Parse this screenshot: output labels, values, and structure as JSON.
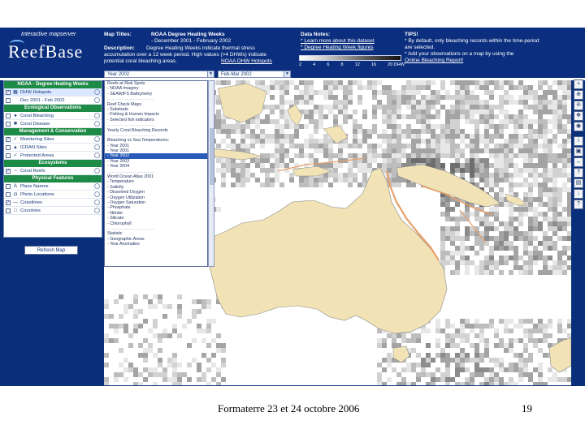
{
  "app": {
    "tagline": "Interactive mapserver",
    "logo": "ReefBase"
  },
  "header": {
    "map_titles_label": "Map Titles:",
    "map_title_line1": "NOAA Degree Heating Weeks",
    "map_title_line2": "- December 2001 - February 2002",
    "description_label": "Description:",
    "description_line1": "Degree Heating Weeks indicate thermal stress",
    "description_line2": "accumulation over a 12 week period. High values (>4 DHWs) indicate",
    "description_line3": "potential coral bleaching areas.",
    "description_link": "NOAA DHW Hotspots",
    "data_notes_label": "Data Notes:",
    "data_notes_1": "* Learn more about this dataset",
    "data_notes_2": "* Degree Heating Week figures",
    "legend_ticks": [
      "2",
      "4",
      "6",
      "8",
      "12",
      "16",
      "20 DHW"
    ],
    "tips_label": "TIPS!",
    "tips_line1": "* By default, only bleaching records within the time-period",
    "tips_line2": "are selected.",
    "tips_line3": "* Add your observations on a map by using the",
    "tips_link": "Online Bleaching Report!"
  },
  "selectors": {
    "left_value": "Year 2002",
    "right_value": "Feb-Mar 2002"
  },
  "layers": {
    "sections": [
      {
        "title": "NOAA - Degree Heating Weeks",
        "rows": [
          {
            "label": "DHW Hotspots",
            "icon": "gradient-icon",
            "glyph": "▦",
            "checked": true,
            "active": true
          },
          {
            "label": "Dec 2001 - Feb 2002",
            "icon": "calendar-icon",
            "glyph": "",
            "checked": false,
            "active": false
          }
        ]
      },
      {
        "title": "Ecological Observations",
        "rows": [
          {
            "label": "Coral Bleaching",
            "icon": "bleaching-icon",
            "glyph": "●",
            "checked": false,
            "active": false
          },
          {
            "label": "Coral Disease",
            "icon": "disease-icon",
            "glyph": "✱",
            "checked": false,
            "active": false
          }
        ]
      },
      {
        "title": "Management & Conservation",
        "rows": [
          {
            "label": "Monitoring Sites",
            "icon": "monitoring-icon",
            "glyph": "✓",
            "checked": true,
            "active": false
          },
          {
            "label": "ICRAN Sites",
            "icon": "icran-icon",
            "glyph": "▲",
            "checked": false,
            "active": false
          },
          {
            "label": "Protected Areas",
            "icon": "protected-icon",
            "glyph": "✓",
            "checked": false,
            "active": false
          }
        ]
      },
      {
        "title": "Ecosystems",
        "rows": [
          {
            "label": "Coral Reefs",
            "icon": "reef-icon",
            "glyph": "~",
            "checked": true,
            "active": false
          }
        ]
      },
      {
        "title": "Physical Features",
        "rows": [
          {
            "label": "Place Names",
            "icon": "placename-icon",
            "glyph": "A",
            "checked": false,
            "active": false
          },
          {
            "label": "Photo Locations",
            "icon": "photo-icon",
            "glyph": "◘",
            "checked": false,
            "active": false
          },
          {
            "label": "Coastlines",
            "icon": "coastline-icon",
            "glyph": "—",
            "checked": true,
            "active": false
          },
          {
            "label": "Countries",
            "icon": "country-icon",
            "glyph": "□",
            "checked": false,
            "active": false
          }
        ]
      }
    ],
    "refresh_label": "Refresh Map"
  },
  "dropdown": {
    "items": [
      {
        "text": "Reefs at Risk Spots",
        "type": "item"
      },
      {
        "text": "- NOAA Imagery",
        "type": "item"
      },
      {
        "text": "- SEAWIFS Bathymetry",
        "type": "item"
      },
      {
        "text": "……………………………",
        "type": "sep"
      },
      {
        "text": "Reef Check Maps",
        "type": "item"
      },
      {
        "text": "- Substrate",
        "type": "item"
      },
      {
        "text": "- Fishing & Human Impacts",
        "type": "item"
      },
      {
        "text": "- Selected fish indicators",
        "type": "item"
      },
      {
        "text": "……………………………",
        "type": "sep"
      },
      {
        "text": "Yearly Coral Bleaching Records",
        "type": "item"
      },
      {
        "text": "……………………………",
        "type": "sep"
      },
      {
        "text": "Bleaching vs Sea Temperatures:",
        "type": "item"
      },
      {
        "text": "- Year 2001",
        "type": "item"
      },
      {
        "text": "- Year 2001",
        "type": "item"
      },
      {
        "text": "- Year 2002",
        "type": "sel"
      },
      {
        "text": "- Year 2003",
        "type": "item"
      },
      {
        "text": "- Year 2004",
        "type": "item"
      },
      {
        "text": "……………………………",
        "type": "sep"
      },
      {
        "text": "World Ocean Atlas 2001",
        "type": "item"
      },
      {
        "text": "- Temperature",
        "type": "item"
      },
      {
        "text": "- Salinity",
        "type": "item"
      },
      {
        "text": "- Dissolved Oxygen",
        "type": "item"
      },
      {
        "text": "- Oxygen Utilization",
        "type": "item"
      },
      {
        "text": "- Oxygen Saturation",
        "type": "item"
      },
      {
        "text": "- Phosphate",
        "type": "item"
      },
      {
        "text": "- Nitrate",
        "type": "item"
      },
      {
        "text": "- Silicate",
        "type": "item"
      },
      {
        "text": "- Chlorophyll",
        "type": "item"
      },
      {
        "text": "……………………………",
        "type": "sep"
      },
      {
        "text": "Statistic",
        "type": "item"
      },
      {
        "text": "- Geographic Areas",
        "type": "item"
      },
      {
        "text": "- Year Anomalies",
        "type": "item"
      }
    ]
  },
  "tools": [
    {
      "name": "zoom-in-icon",
      "glyph": "+"
    },
    {
      "name": "zoom-in-area-icon",
      "glyph": "⊕"
    },
    {
      "name": "zoom-out-icon",
      "glyph": "⊖"
    },
    {
      "name": "pan-icon",
      "glyph": "✥"
    },
    {
      "name": "full-extent-icon",
      "glyph": "◉"
    },
    {
      "name": "identify-icon",
      "glyph": "i"
    },
    {
      "name": "select-icon",
      "glyph": "▣"
    },
    {
      "name": "measure-icon",
      "glyph": "↔"
    },
    {
      "name": "query-icon",
      "glyph": "?"
    },
    {
      "name": "print-icon",
      "glyph": "▤"
    },
    {
      "name": "download-icon",
      "glyph": "↓"
    },
    {
      "name": "help-icon",
      "glyph": "?"
    }
  ],
  "colors": {
    "header_bg": "#0b2f7e",
    "section_green": "#1d8a45",
    "land": "#f1e3b6",
    "reef_orange": "#e8a06a",
    "selection_blue": "#2a5bb8"
  },
  "footer": {
    "caption": "Formaterre 23 et 24 octobre 2006",
    "page": "19"
  }
}
